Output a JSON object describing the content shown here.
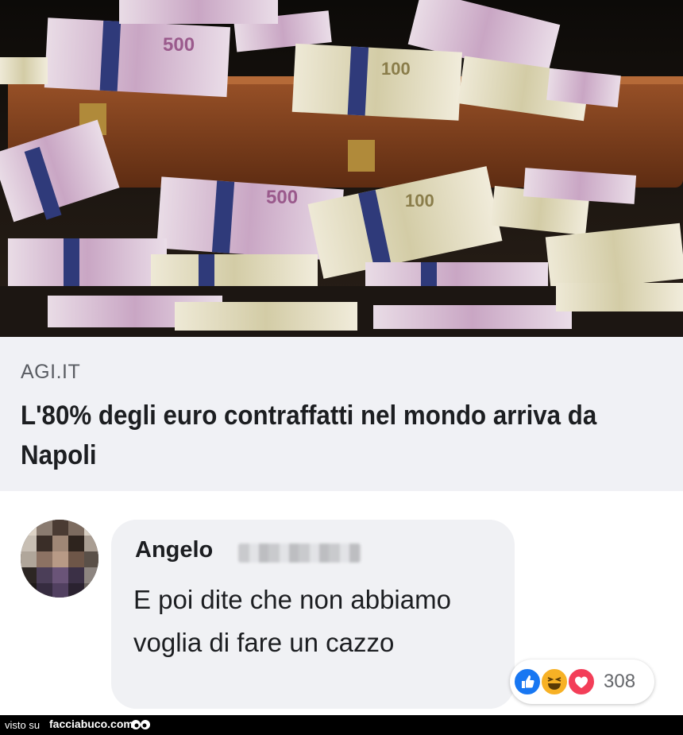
{
  "link_preview": {
    "domain": "AGI.IT",
    "headline": "L'80% degli euro contraffatti nel mondo arriva da Napoli"
  },
  "comment": {
    "author": "Angelo",
    "text": "E poi dite che non abbiamo voglia di fare un cazzo",
    "reactions": {
      "icons": [
        "like-icon",
        "haha-icon",
        "love-icon"
      ],
      "count": "308"
    }
  },
  "footer": {
    "prefix": "visto su",
    "brand": "facciabuco.com"
  },
  "colors": {
    "like": "#1877f2",
    "haha": "#f7b125",
    "love": "#f33e58",
    "bubble": "#f0f1f4",
    "card": "#f0f1f5"
  }
}
